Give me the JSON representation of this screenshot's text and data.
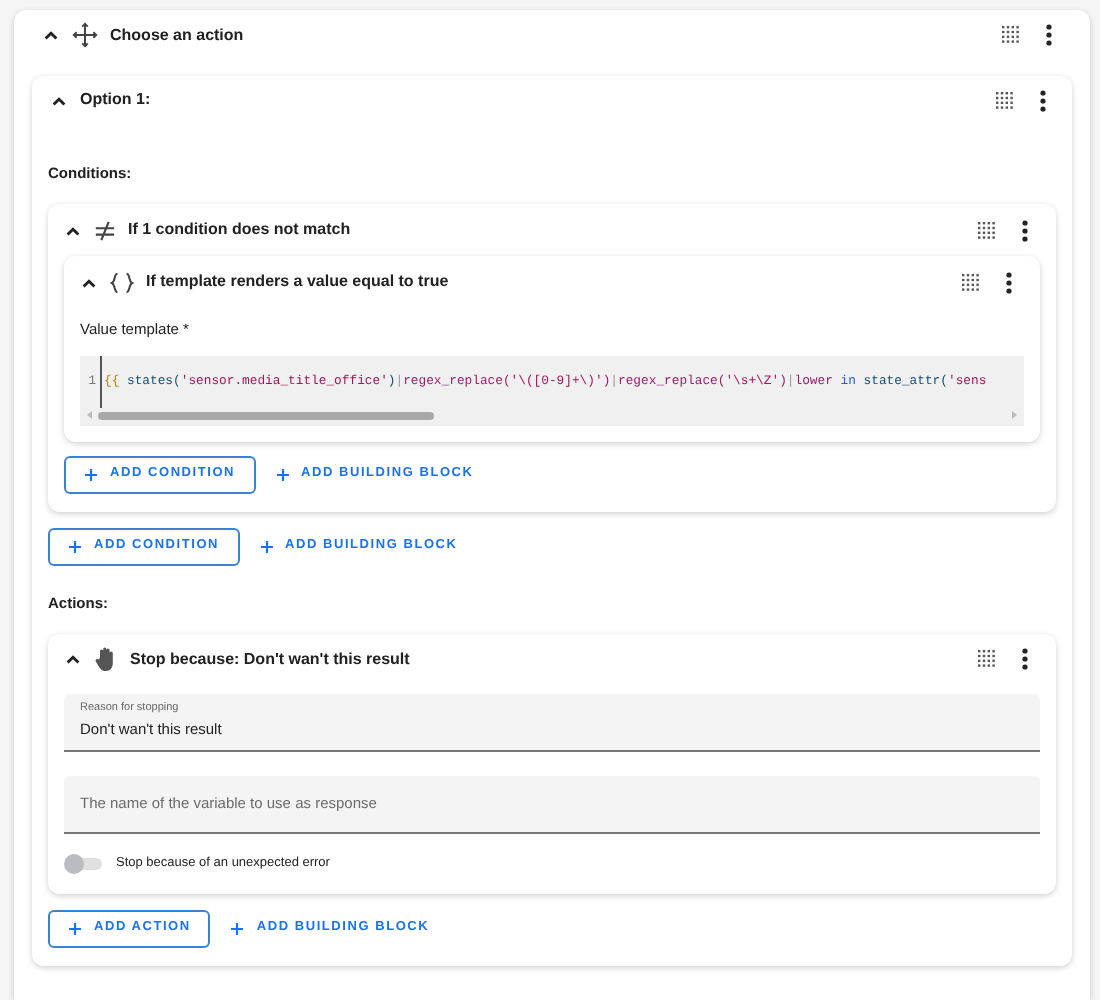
{
  "block": {
    "title": "Choose an action",
    "expanded": true,
    "options": [
      {
        "title": "Option 1:",
        "expanded": true,
        "conditions_heading": "Conditions:",
        "conditions": [
          {
            "kind": "not",
            "title": "If 1 condition does not match",
            "expanded": true,
            "conditions": [
              {
                "kind": "template",
                "title": "If template renders a value equal to true",
                "expanded": true,
                "field_label": "Value template *",
                "line_number": "1",
                "code": [
                  {
                    "text": "{{",
                    "kind": "brace"
                  },
                  {
                    "text": " states(",
                    "kind": "name"
                  },
                  {
                    "text": "'sensor.media_title_office'",
                    "kind": "string"
                  },
                  {
                    "text": ")",
                    "kind": "name"
                  },
                  {
                    "text": "|",
                    "kind": "pipe"
                  },
                  {
                    "text": "regex_replace(",
                    "kind": "filter"
                  },
                  {
                    "text": "'\\([0-9]+\\)'",
                    "kind": "string"
                  },
                  {
                    "text": ")",
                    "kind": "filter"
                  },
                  {
                    "text": "|",
                    "kind": "pipe"
                  },
                  {
                    "text": "regex_replace(",
                    "kind": "filter"
                  },
                  {
                    "text": "'\\s+\\Z'",
                    "kind": "string"
                  },
                  {
                    "text": ")",
                    "kind": "filter"
                  },
                  {
                    "text": "|",
                    "kind": "pipe"
                  },
                  {
                    "text": "lower",
                    "kind": "filter"
                  },
                  {
                    "text": " in ",
                    "kind": "keyword"
                  },
                  {
                    "text": "state_attr(",
                    "kind": "name"
                  },
                  {
                    "text": "'sens",
                    "kind": "string"
                  }
                ]
              }
            ],
            "buttons": [
              {
                "label": "ADD CONDITION",
                "kind": "outlined"
              },
              {
                "label": "ADD BUILDING BLOCK",
                "kind": "text"
              }
            ]
          }
        ],
        "condition_buttons": [
          {
            "label": "ADD CONDITION",
            "kind": "outlined"
          },
          {
            "label": "ADD BUILDING BLOCK",
            "kind": "text"
          }
        ],
        "actions_heading": "Actions:",
        "actions": [
          {
            "kind": "stop",
            "title": "Stop because: Don't wan't this result",
            "expanded": true,
            "fields": [
              {
                "label": "Reason for stopping",
                "value": "Don't wan't this result"
              },
              {
                "placeholder": "The name of the variable to use as response"
              }
            ],
            "toggle": {
              "label": "Stop because of an unexpected error",
              "on": false
            }
          }
        ],
        "action_buttons": [
          {
            "label": "ADD ACTION",
            "kind": "outlined"
          },
          {
            "label": "ADD BUILDING BLOCK",
            "kind": "text"
          }
        ]
      }
    ]
  }
}
